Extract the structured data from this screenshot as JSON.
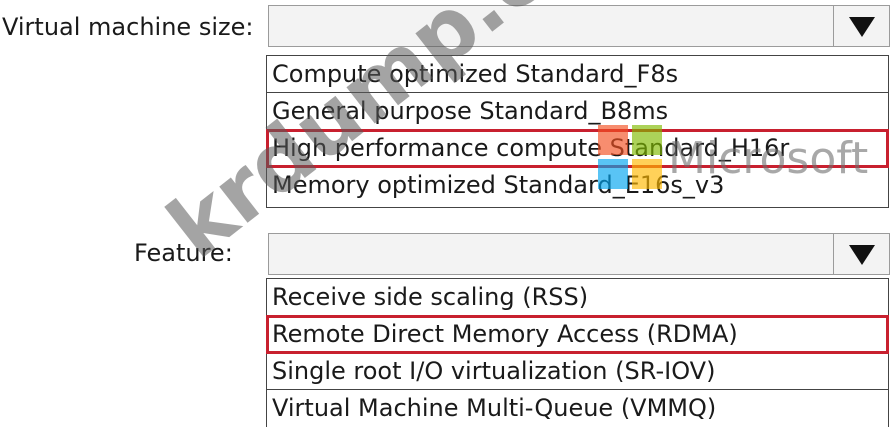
{
  "vm_size": {
    "label": "Virtual machine size:",
    "options": [
      "Compute optimized Standard_F8s",
      "General purpose Standard_B8ms",
      "High performance compute Standard_H16r",
      "Memory optimized Standard_E16s_v3"
    ],
    "highlighted_index": 2
  },
  "feature": {
    "label": "Feature:",
    "options": [
      "Receive side scaling (RSS)",
      "Remote Direct Memory Access (RDMA)",
      "Single root I/O virtualization (SR-IOV)",
      "Virtual Machine Multi-Queue (VMMQ)"
    ],
    "highlighted_index": 1
  },
  "watermark": {
    "site_text": "krdump.com",
    "brand_text": "Microsoft",
    "logo_colors": [
      "#f25022",
      "#7fba00",
      "#00a4ef",
      "#ffb900"
    ]
  },
  "colors": {
    "highlight_border": "#c8202f"
  },
  "icons": {
    "dropdown": "triangle-down-icon"
  }
}
